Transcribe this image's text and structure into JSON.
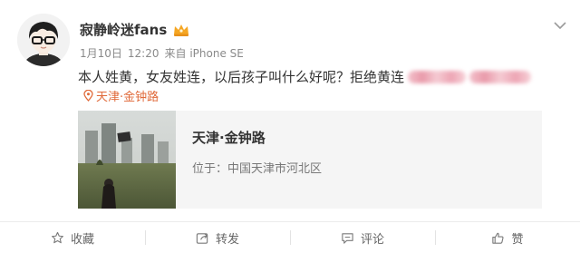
{
  "post": {
    "username": "寂静岭迷fans",
    "meta": {
      "date": "1月10日",
      "time": "12:20",
      "source": "来自 iPhone SE"
    },
    "content_text": "本人姓黄，女友姓连，以后孩子叫什么好呢？拒绝黄连",
    "location_tag": "天津·金钟路",
    "place_card": {
      "name": "天津·金钟路",
      "address": "位于：中国天津市河北区"
    }
  },
  "actions": {
    "favorite_label": "收藏",
    "repost_label": "转发",
    "comment_label": "评论",
    "like_label": "赞"
  },
  "colors": {
    "accent": "#e06a3a",
    "text": "#333333",
    "meta": "#8a8a8a",
    "card_bg": "#f5f5f5"
  },
  "icons": {
    "avatar": "cartoon-boy-with-glasses",
    "badge": "vip-crown-icon",
    "dropdown": "chevron-down-icon",
    "location": "location-pin-icon",
    "favorite": "star-icon",
    "repost": "share-arrow-icon",
    "comment": "comment-bubble-icon",
    "like": "thumbs-up-icon"
  }
}
